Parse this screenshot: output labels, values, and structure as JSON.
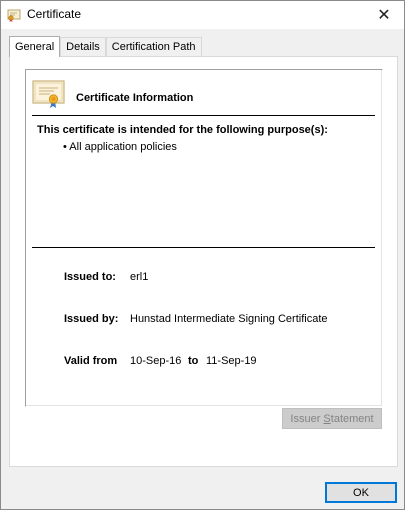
{
  "window": {
    "title": "Certificate",
    "close_symbol": "✕"
  },
  "tabs": [
    {
      "label": "General",
      "active": true
    },
    {
      "label": "Details",
      "active": false
    },
    {
      "label": "Certification Path",
      "active": false
    }
  ],
  "general": {
    "heading": "Certificate Information",
    "purpose_title": "This certificate is intended for the following purpose(s):",
    "purposes": [
      "• All application policies"
    ],
    "issued_to_label": "Issued to:",
    "issued_to": "erl1",
    "issued_by_label": "Issued by:",
    "issued_by": "Hunstad Intermediate Signing Certificate",
    "valid_from_label": "Valid from",
    "valid_from": "10-Sep-16",
    "valid_to_label": "to",
    "valid_to": "11-Sep-19"
  },
  "buttons": {
    "issuer_statement_pre": "Issuer ",
    "issuer_statement_underlined": "S",
    "issuer_statement_post": "tatement",
    "ok": "OK"
  },
  "colors": {
    "focus_border": "#0078d7",
    "disabled_text": "#838383"
  },
  "icons": {
    "title": "certificate-icon",
    "close": "close-icon",
    "cert": "certificate-icon"
  }
}
